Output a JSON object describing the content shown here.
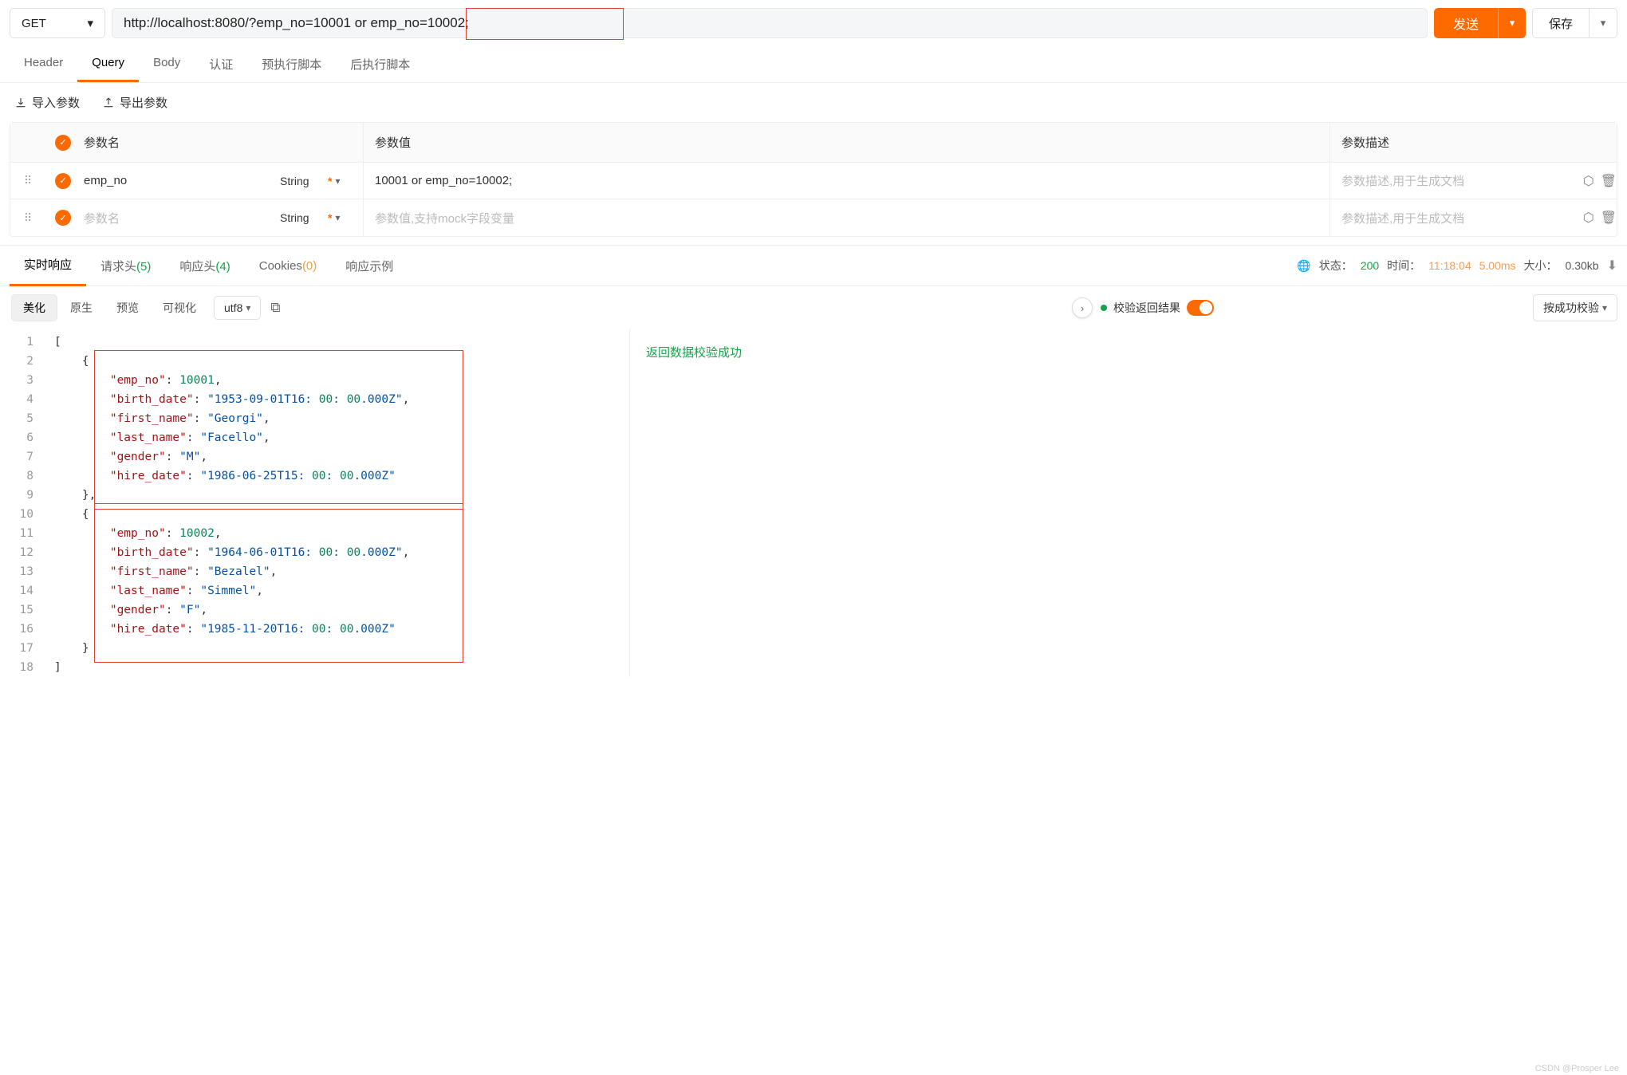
{
  "request": {
    "method": "GET",
    "url": "http://localhost:8080/?emp_no=10001 or emp_no=10002;",
    "send_label": "发送",
    "save_label": "保存"
  },
  "request_tabs": [
    "Header",
    "Query",
    "Body",
    "认证",
    "预执行脚本",
    "后执行脚本"
  ],
  "active_request_tab": 1,
  "param_actions": {
    "import": "导入参数",
    "export": "导出参数"
  },
  "param_headers": {
    "name": "参数名",
    "value": "参数值",
    "desc": "参数描述"
  },
  "param_type_label": "String",
  "params": [
    {
      "name": "emp_no",
      "value": "10001 or emp_no=10002;",
      "desc_placeholder": "参数描述,用于生成文档"
    },
    {
      "name_placeholder": "参数名",
      "value_placeholder": "参数值,支持mock字段变量",
      "desc_placeholder": "参数描述,用于生成文档"
    }
  ],
  "response_tabs": {
    "realtime": "实时响应",
    "req_headers": "请求头",
    "req_headers_count": "(5)",
    "resp_headers": "响应头",
    "resp_headers_count": "(4)",
    "cookies": "Cookies",
    "cookies_count": "(0)",
    "example": "响应示例"
  },
  "response_status": {
    "status_label": "状态：",
    "status_code": "200",
    "time_label": "时间：",
    "time_value": "11:18:04",
    "duration": "5.00ms",
    "size_label": "大小：",
    "size_value": "0.30kb"
  },
  "view_toolbar": {
    "pretty": "美化",
    "raw": "原生",
    "preview": "预览",
    "visual": "可视化",
    "encoding": "utf8"
  },
  "validation": {
    "label": "校验返回结果",
    "by_label": "按成功校验",
    "result": "返回数据校验成功"
  },
  "code_lines": [
    "[",
    "    {",
    "        \"emp_no\": 10001,",
    "        \"birth_date\": \"1953-09-01T16:00:00.000Z\",",
    "        \"first_name\": \"Georgi\",",
    "        \"last_name\": \"Facello\",",
    "        \"gender\": \"M\",",
    "        \"hire_date\": \"1986-06-25T15:00:00.000Z\"",
    "    },",
    "    {",
    "        \"emp_no\": 10002,",
    "        \"birth_date\": \"1964-06-01T16:00:00.000Z\",",
    "        \"first_name\": \"Bezalel\",",
    "        \"last_name\": \"Simmel\",",
    "        \"gender\": \"F\",",
    "        \"hire_date\": \"1985-11-20T16:00:00.000Z\"",
    "    }",
    "]"
  ],
  "watermark": "CSDN @Prosper Lee"
}
